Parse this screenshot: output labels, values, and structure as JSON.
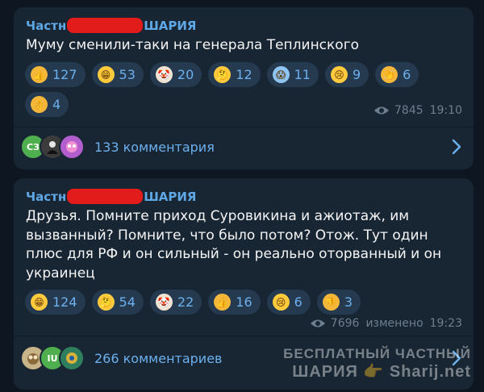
{
  "posts": [
    {
      "channel_prefix": "Частн",
      "channel_suffix": "ШАРИЯ",
      "text": "Муму сменили-таки на генерала Теплинского",
      "reactions": [
        {
          "emoji": "thumbs-up",
          "count": "127"
        },
        {
          "emoji": "grinning-face",
          "count": "53"
        },
        {
          "emoji": "clown-face",
          "count": "20"
        },
        {
          "emoji": "thinking-face",
          "count": "12"
        },
        {
          "emoji": "screaming-face",
          "count": "11"
        },
        {
          "emoji": "crying-face",
          "count": "9"
        },
        {
          "emoji": "clapping-hands",
          "count": "6"
        },
        {
          "emoji": "ok-hand",
          "count": "4"
        }
      ],
      "views": "7845",
      "edited": "",
      "time": "19:10",
      "comments_label": "133 комментария",
      "avatars": [
        {
          "initials": "СЗ",
          "color": "#4fae4e"
        },
        {
          "initials": "",
          "color": "#3b3b3b"
        },
        {
          "initials": "",
          "color": "#b35ecf"
        }
      ]
    },
    {
      "channel_prefix": "Частн",
      "channel_suffix": "ШАРИЯ",
      "text": "Друзья. Помните приход Суровикина и ажиотаж, им вызванный? Помните, что было потом? Отож. Тут один плюс для РФ и он сильный - он реально оторванный и он украинец",
      "reactions": [
        {
          "emoji": "grinning-face",
          "count": "124"
        },
        {
          "emoji": "thinking-face",
          "count": "54"
        },
        {
          "emoji": "clown-face",
          "count": "22"
        },
        {
          "emoji": "thumbs-up",
          "count": "16"
        },
        {
          "emoji": "crying-face",
          "count": "6"
        },
        {
          "emoji": "thumbs-down",
          "count": "3"
        }
      ],
      "views": "7696",
      "edited": "изменено",
      "time": "19:23",
      "comments_label": "266 комментариев",
      "avatars": [
        {
          "initials": "",
          "color": "#c9b48a"
        },
        {
          "initials": "IU",
          "color": "#4fae4e"
        },
        {
          "initials": "",
          "color": "#2f7f5f"
        }
      ]
    }
  ],
  "watermark": {
    "line1": "БЕСПЛАТНЫЙ ЧАСТНЫЙ",
    "line2": "ШАРИЯ 👉 Sharij.net"
  },
  "colors": {
    "background": "#0e1621",
    "bubble": "#182533",
    "accent": "#6cb0ee",
    "redaction": "#e21b1b"
  }
}
